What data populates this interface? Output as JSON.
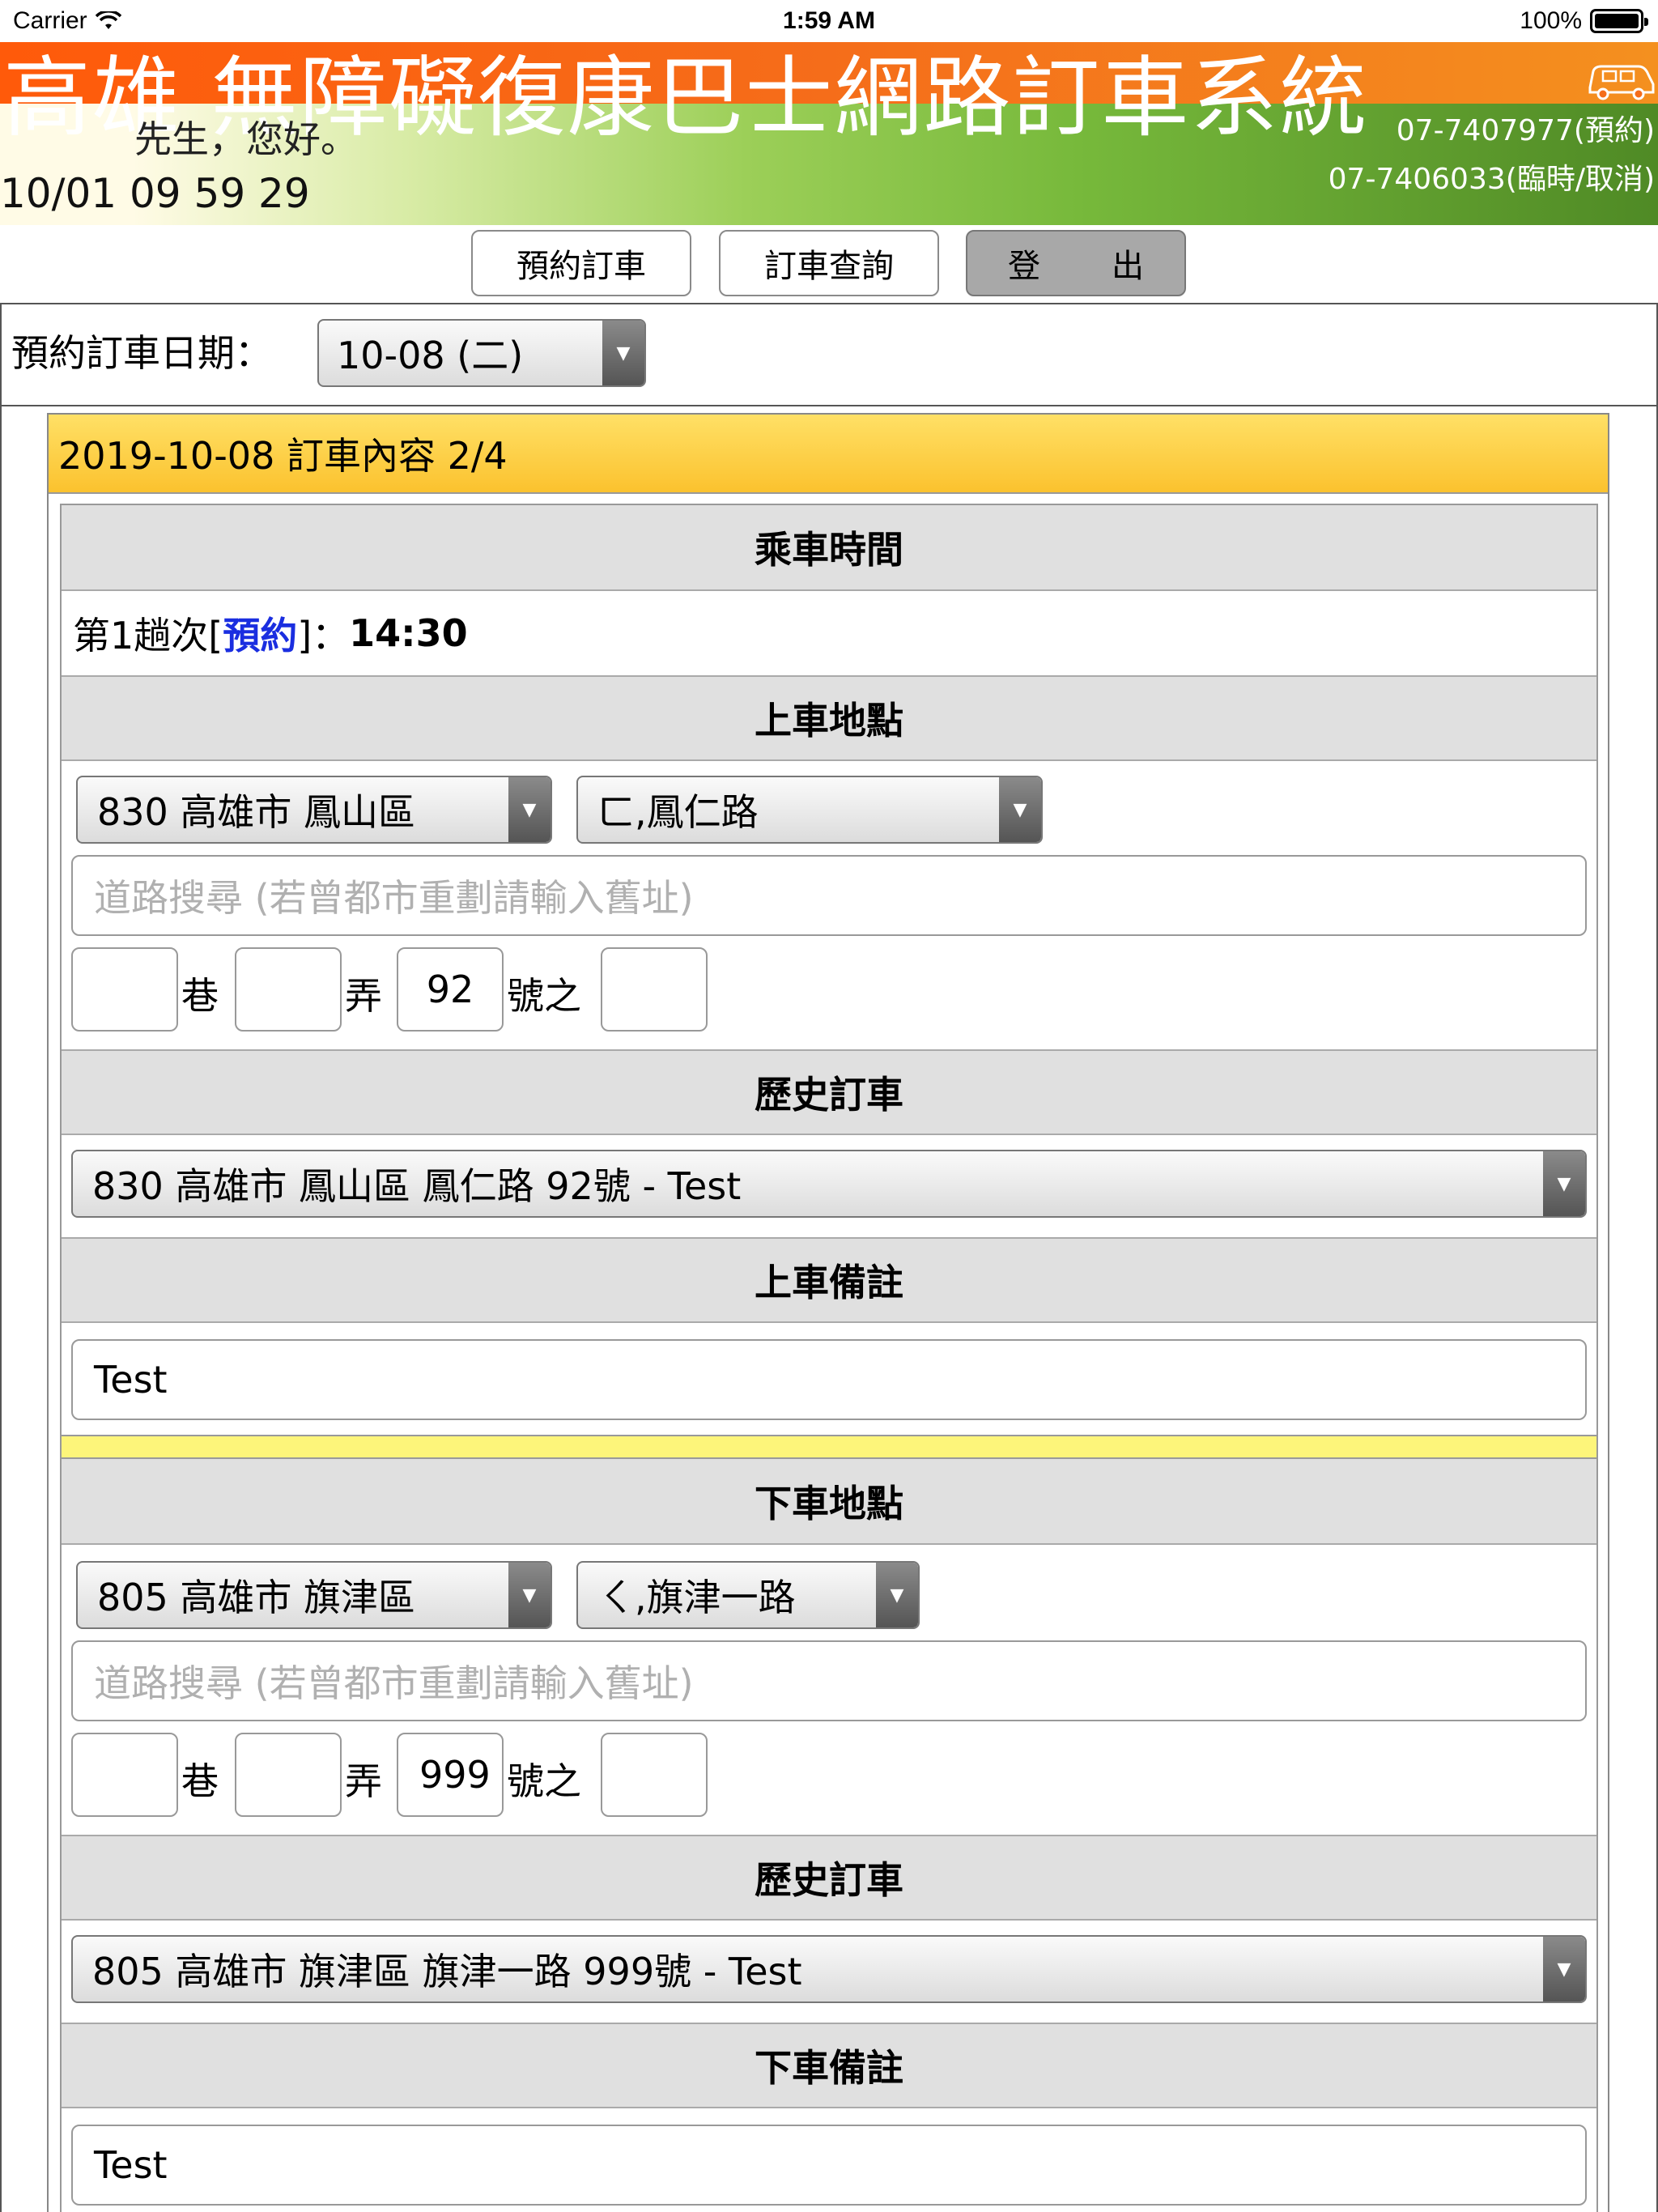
{
  "status_bar": {
    "carrier": "Carrier",
    "time": "1:59 AM",
    "battery": "100%"
  },
  "header": {
    "title": "高雄 無障礙復康巴士網路訂車系統",
    "greeting": "先生，您好。",
    "clock": "10/01 09 59 29",
    "phone_booking": "07-7407977(預約)",
    "phone_cancel": "07-7406033(臨時/取消)"
  },
  "nav": {
    "book": "預約訂車",
    "query": "訂車查詢",
    "logout": "登　出"
  },
  "date_selector": {
    "label": "預約訂車日期：",
    "value": "10-08 (二)"
  },
  "order": {
    "header": "2019-10-08 訂車內容 2/4",
    "ride_time_title": "乘車時間",
    "ride_prefix": "第1趟次[",
    "ride_type": "預約",
    "ride_suffix": "]：",
    "ride_time": "14:30",
    "pickup": {
      "title": "上車地點",
      "district": "830 高雄市 鳳山區",
      "road": "ㄈ,鳳仁路",
      "search_placeholder": "道路搜尋 (若曾都市重劃請輸入舊址)",
      "lane": "",
      "lane_label": "巷",
      "alley": "",
      "alley_label": "弄",
      "number": "92",
      "number_label": "號之",
      "sub": "",
      "history_title": "歷史訂車",
      "history_value": "830 高雄市 鳳山區 鳳仁路 92號 - Test",
      "note_title": "上車備註",
      "note_value": "Test"
    },
    "dropoff": {
      "title": "下車地點",
      "district": "805 高雄市 旗津區",
      "road": "ㄑ,旗津一路",
      "search_placeholder": "道路搜尋 (若曾都市重劃請輸入舊址)",
      "lane": "",
      "lane_label": "巷",
      "alley": "",
      "alley_label": "弄",
      "number": "999",
      "number_label": "號之",
      "sub": "",
      "history_title": "歷史訂車",
      "history_value": "805 高雄市 旗津區 旗津一路 999號 - Test",
      "note_title": "下車備註",
      "note_value": "Test"
    }
  },
  "icons": {
    "wifi": "wifi-icon",
    "battery": "battery-icon",
    "van": "van-icon",
    "dropdown": "triangle-down"
  },
  "colors": {
    "banner_orange": "#f56d1a",
    "banner_green": "#77b93b",
    "order_header": "#fbc22e",
    "link_blue": "#1a2ee0",
    "section_gray": "#e0e0e0",
    "separator_yellow": "#fdf57a"
  }
}
